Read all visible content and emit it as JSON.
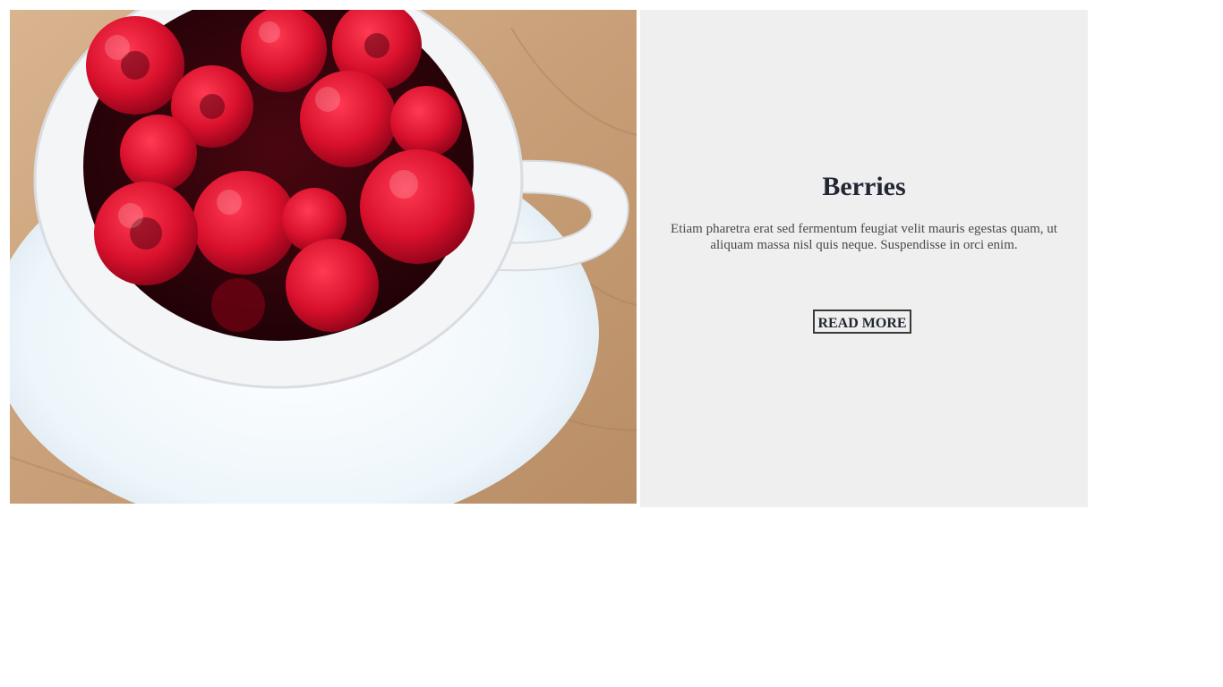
{
  "card": {
    "image": {
      "alt": "Raspberries in a white cup on a saucer",
      "icon": "raspberries-photo"
    },
    "title": "Berries",
    "description": "Etiam pharetra erat sed fermentum feugiat velit mauris egestas quam, ut aliquam massa nisl quis neque. Suspendisse in orci enim.",
    "button_label": "READ MORE"
  },
  "colors": {
    "panel_background": "#efefef",
    "title_text": "#232733",
    "body_text": "#4a4a4a",
    "button_border": "#3a3a3a"
  }
}
